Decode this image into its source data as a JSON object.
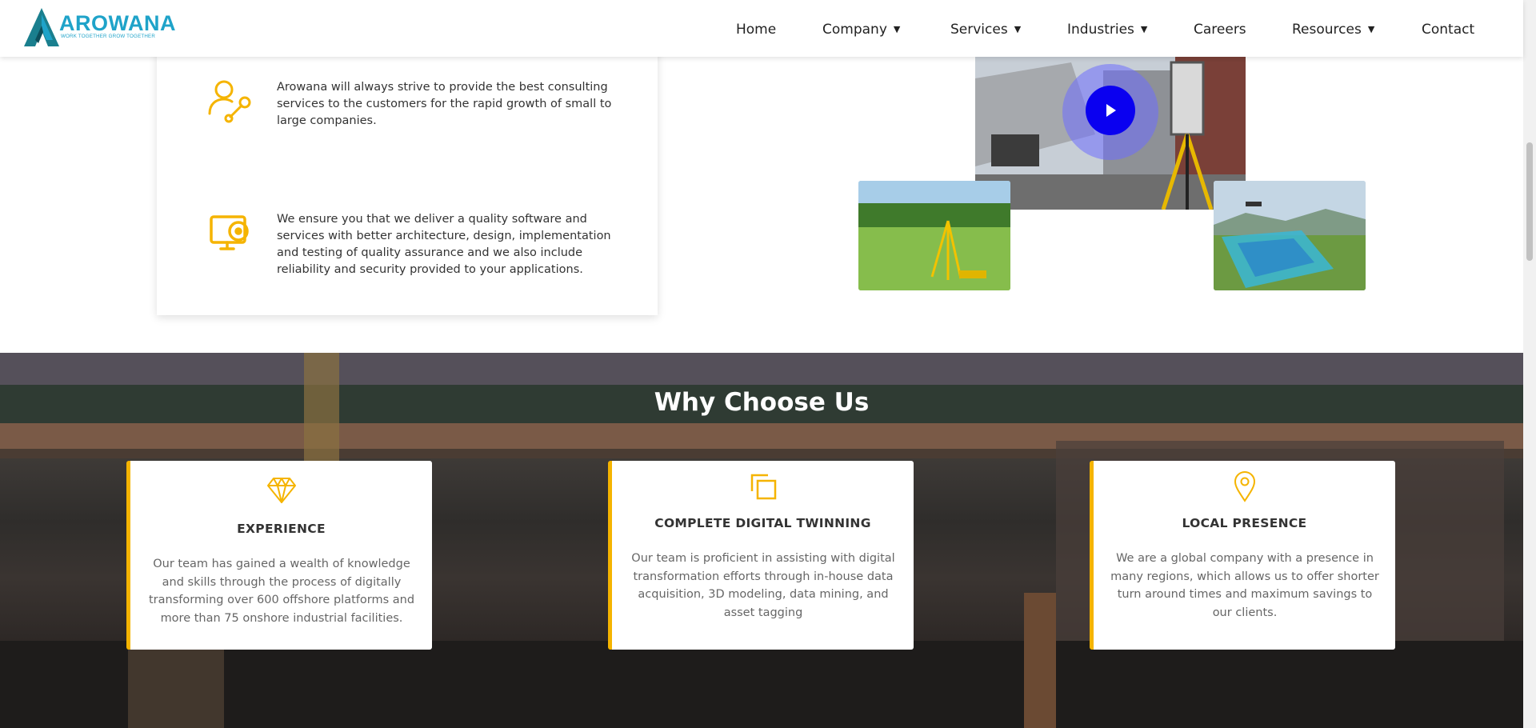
{
  "brand": {
    "name": "AROWANA",
    "tagline": "WORK TOGETHER GROW TOGETHER",
    "primary_color": "#1fa3c9",
    "accent_color": "#f5b400"
  },
  "nav": {
    "items": [
      {
        "label": "Home",
        "dropdown": false
      },
      {
        "label": "Company",
        "dropdown": true
      },
      {
        "label": "Services",
        "dropdown": true
      },
      {
        "label": "Industries",
        "dropdown": true
      },
      {
        "label": "Careers",
        "dropdown": false
      },
      {
        "label": "Resources",
        "dropdown": true
      },
      {
        "label": "Contact",
        "dropdown": false
      }
    ],
    "caret": "▼"
  },
  "services_card": {
    "items": [
      {
        "icon": "user-wrench-icon",
        "text": "Arowana will always strive to provide the best consulting services to the customers for the rapid growth of small to large companies."
      },
      {
        "icon": "monitor-gear-icon",
        "text": "We ensure you that we deliver a quality software and services with better architecture, design, implementation and testing of quality assurance and we also include reliability and security provided to your applications."
      }
    ]
  },
  "media": {
    "play_button_color": "#0a00f0"
  },
  "why": {
    "title": "Why Choose Us",
    "cards": [
      {
        "icon": "diamond-icon",
        "title": "EXPERIENCE",
        "text": "Our team has gained a wealth of knowledge and skills through the process of digitally transforming over 600 offshore platforms and more than 75 onshore industrial facilities."
      },
      {
        "icon": "copy-squares-icon",
        "title": "COMPLETE DIGITAL TWINNING",
        "text": "Our team is proficient in assisting with digital transformation efforts through in-house data acquisition, 3D modeling, data mining, and asset tagging"
      },
      {
        "icon": "map-pin-icon",
        "title": "LOCAL PRESENCE",
        "text": "We are a global company with a presence in many regions, which allows us to offer shorter turn around times and maximum savings to our clients."
      }
    ]
  }
}
